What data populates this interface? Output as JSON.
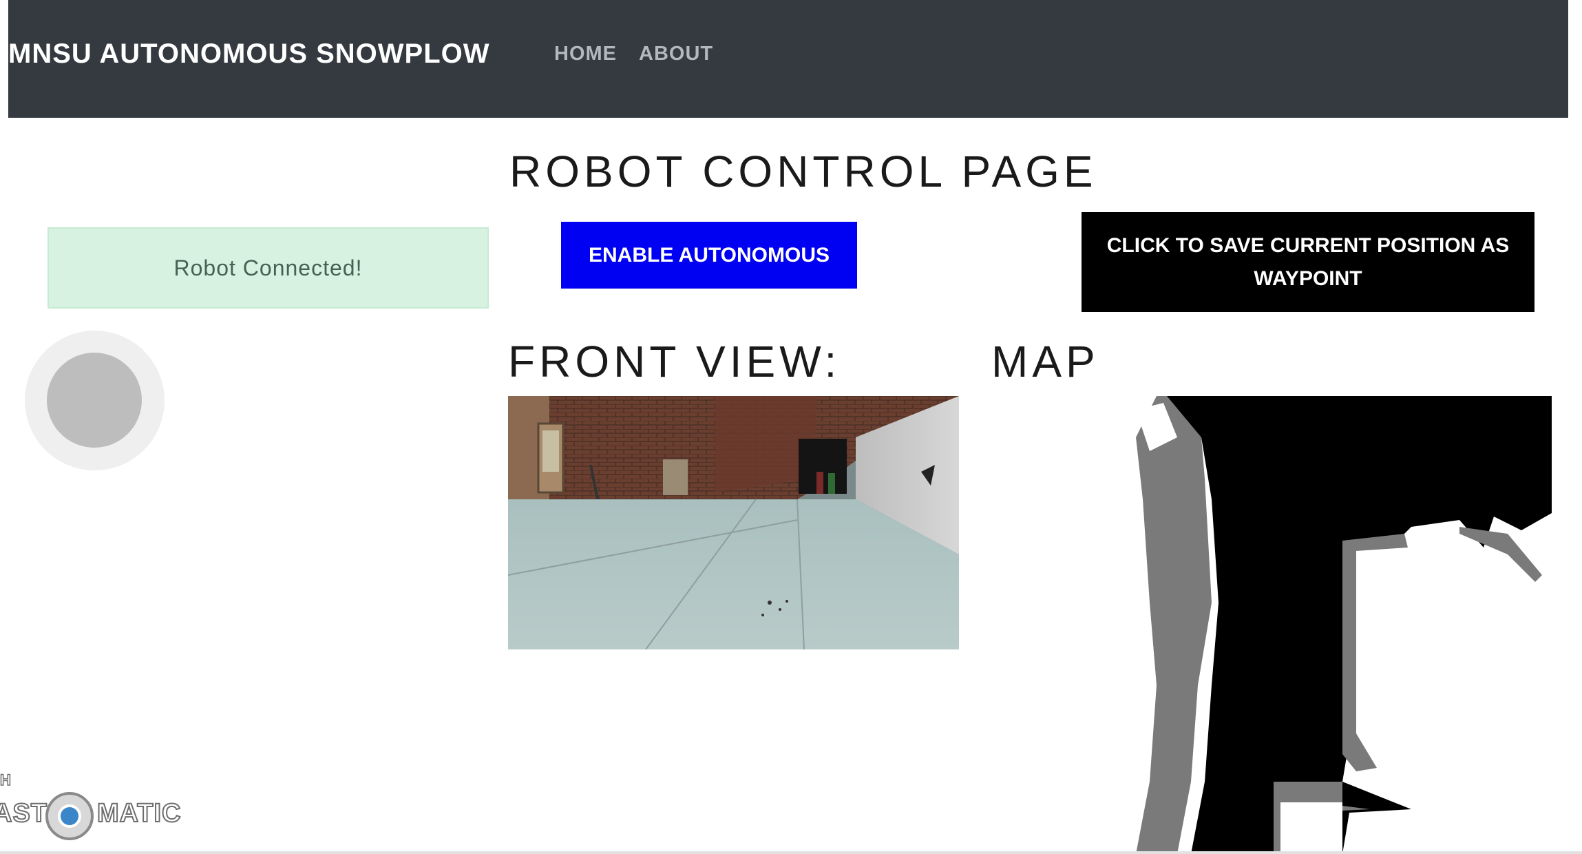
{
  "navbar": {
    "brand": "MNSU AUTONOMOUS SNOWPLOW",
    "links": [
      {
        "label": "HOME"
      },
      {
        "label": "ABOUT"
      }
    ],
    "background": "#343a40"
  },
  "page": {
    "title": "ROBOT CONTROL PAGE"
  },
  "status": {
    "message": "Robot Connected!",
    "color": "#d8f2e2"
  },
  "controls": {
    "autonomous_label": "ENABLE AUTONOMOUS",
    "autonomous_color": "#0000f2",
    "waypoint_label": "CLICK TO SAVE CURRENT POSITION AS WAYPOINT",
    "waypoint_color": "#000000"
  },
  "sections": {
    "front_view": "FRONT VIEW:",
    "map": "MAP"
  },
  "joystick": {
    "icon": "joystick-icon"
  },
  "watermark": {
    "top": "H",
    "left": "AST",
    "right": "MATIC",
    "icon": "screencast-logo-icon"
  }
}
